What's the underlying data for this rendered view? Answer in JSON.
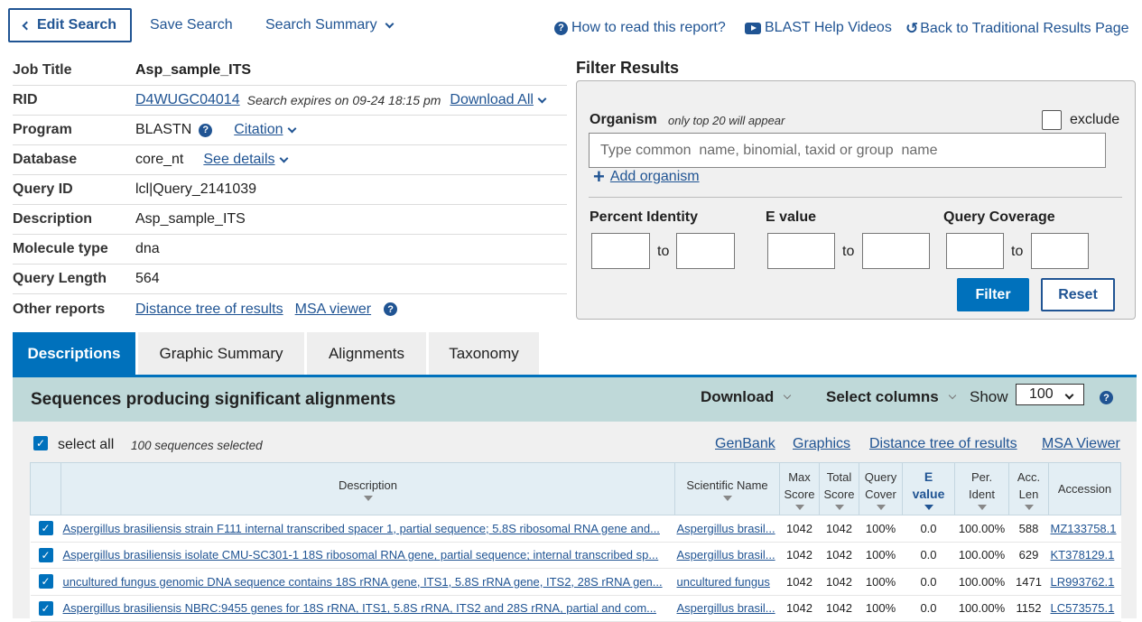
{
  "topbar": {
    "edit_search": "Edit Search",
    "save_search": "Save Search",
    "search_summary": "Search Summary",
    "how_to_read": "How to read this report?",
    "help_videos": "BLAST Help Videos",
    "back_traditional": "Back to Traditional Results Page"
  },
  "job": {
    "labels": {
      "job_title": "Job Title",
      "rid": "RID",
      "program": "Program",
      "database": "Database",
      "query_id": "Query ID",
      "description": "Description",
      "molecule_type": "Molecule type",
      "query_length": "Query Length",
      "other_reports": "Other reports"
    },
    "job_title": "Asp_sample_ITS",
    "rid": "D4WUGC04014",
    "expires": "Search expires on 09-24 18:15 pm",
    "download_all": "Download All",
    "program": "BLASTN",
    "citation": "Citation",
    "database": "core_nt",
    "see_details": "See details",
    "query_id": "lcl|Query_2141039",
    "description": "Asp_sample_ITS",
    "molecule_type": "dna",
    "query_length": "564",
    "distance_tree": "Distance tree of results",
    "msa_viewer": "MSA viewer"
  },
  "filter": {
    "title": "Filter Results",
    "organism_label": "Organism",
    "organism_hint": "only top 20 will appear",
    "exclude": "exclude",
    "organism_placeholder": "Type common  name, binomial, taxid or group  name",
    "add_organism": "Add organism",
    "percent_identity": "Percent Identity",
    "e_value": "E value",
    "query_coverage": "Query Coverage",
    "to": "to",
    "filter_btn": "Filter",
    "reset_btn": "Reset"
  },
  "tabs": [
    {
      "label": "Descriptions"
    },
    {
      "label": "Graphic Summary"
    },
    {
      "label": "Alignments"
    },
    {
      "label": "Taxonomy"
    }
  ],
  "results": {
    "title": "Sequences producing significant alignments",
    "download": "Download",
    "select_columns": "Select columns",
    "show": "Show",
    "show_value": "100",
    "select_all": "select all",
    "selected_count": "100 sequences selected",
    "links": {
      "genbank": "GenBank",
      "graphics": "Graphics",
      "distance_tree": "Distance tree of results",
      "msa_viewer": "MSA Viewer"
    },
    "columns": {
      "description": "Description",
      "scientific_name": "Scientific Name",
      "max_score_1": "Max",
      "max_score_2": "Score",
      "total_score_1": "Total",
      "total_score_2": "Score",
      "query_cover_1": "Query",
      "query_cover_2": "Cover",
      "e_value_1": "E",
      "e_value_2": "value",
      "per_ident_1": "Per.",
      "per_ident_2": "Ident",
      "acc_len_1": "Acc.",
      "acc_len_2": "Len",
      "accession": "Accession"
    },
    "rows": [
      {
        "description": "Aspergillus brasiliensis strain F111 internal transcribed spacer 1, partial sequence; 5.8S ribosomal RNA gene and...",
        "scientific_name": "Aspergillus brasil...",
        "max_score": "1042",
        "total_score": "1042",
        "query_cover": "100%",
        "e_value": "0.0",
        "per_ident": "100.00%",
        "acc_len": "588",
        "accession": "MZ133758.1"
      },
      {
        "description": "Aspergillus brasiliensis isolate CMU-SC301-1 18S ribosomal RNA gene, partial sequence; internal transcribed sp...",
        "scientific_name": "Aspergillus brasil...",
        "max_score": "1042",
        "total_score": "1042",
        "query_cover": "100%",
        "e_value": "0.0",
        "per_ident": "100.00%",
        "acc_len": "629",
        "accession": "KT378129.1"
      },
      {
        "description": "uncultured fungus genomic DNA sequence contains 18S rRNA gene, ITS1, 5.8S rRNA gene, ITS2, 28S rRNA gen...",
        "scientific_name": "uncultured fungus",
        "max_score": "1042",
        "total_score": "1042",
        "query_cover": "100%",
        "e_value": "0.0",
        "per_ident": "100.00%",
        "acc_len": "1471",
        "accession": "LR993762.1"
      },
      {
        "description": "Aspergillus brasiliensis NBRC:9455 genes for 18S rRNA, ITS1, 5.8S rRNA, ITS2 and 28S rRNA, partial and com...",
        "scientific_name": "Aspergillus brasil...",
        "max_score": "1042",
        "total_score": "1042",
        "query_cover": "100%",
        "e_value": "0.0",
        "per_ident": "100.00%",
        "acc_len": "1152",
        "accession": "LC573575.1"
      }
    ]
  },
  "colors": {
    "link_blue": "#205493",
    "primary_blue": "#0071bc",
    "header_teal": "#bfd9d9",
    "panel_gray": "#f0f0f0"
  }
}
